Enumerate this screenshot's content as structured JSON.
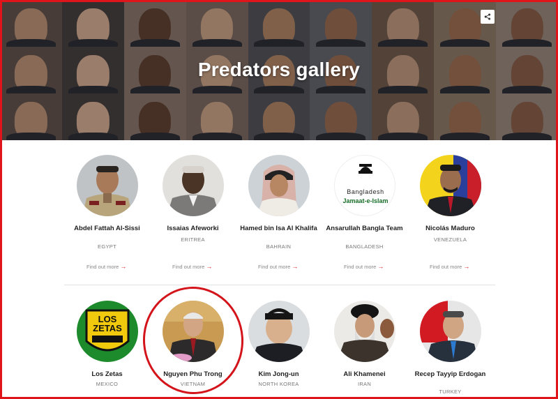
{
  "hero": {
    "title": "Predators gallery",
    "share_icon": "share-icon"
  },
  "find_out_more_label": "Find out more",
  "arrow_glyph": "→",
  "row1": [
    {
      "name": "Abdel Fattah Al-Sissi",
      "country": "EGYPT"
    },
    {
      "name": "Issaias Afeworki",
      "country": "ERITREA"
    },
    {
      "name": "Hamed bin Isa Al Khalifa",
      "country": "BAHRAIN"
    },
    {
      "name": "Ansarullah Bangla Team",
      "country": "BANGLADESH",
      "logo_text": "Bangladesh",
      "logo_text2": "Jamaat-e-Islam"
    },
    {
      "name": "Nicolás Maduro",
      "country": "VENEZUELA"
    }
  ],
  "row2": [
    {
      "name": "Los Zetas",
      "country": "MEXICO",
      "logo_text": "LOS ZETAS"
    },
    {
      "name": "Nguyen Phu Trong",
      "country": "VIETNAM"
    },
    {
      "name": "Kim Jong-un",
      "country": "NORTH KOREA"
    },
    {
      "name": "Ali Khamenei",
      "country": "IRAN"
    },
    {
      "name": "Recep Tayyip Erdogan",
      "country": "TURKEY"
    }
  ],
  "colors": {
    "accent": "#e0141b",
    "annotation": "#d3141b"
  }
}
